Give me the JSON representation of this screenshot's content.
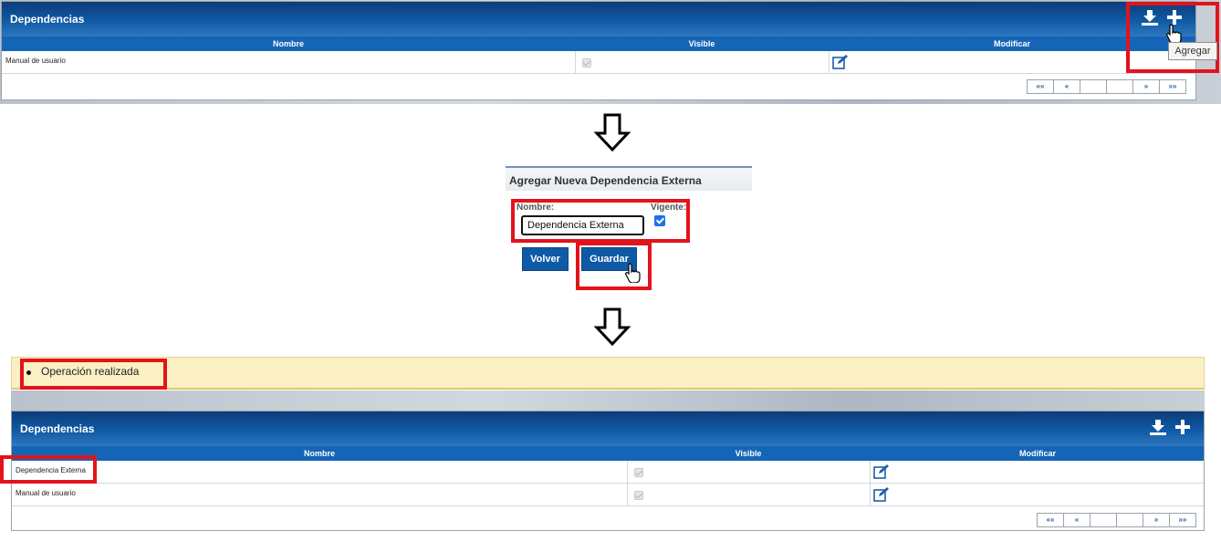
{
  "top_panel": {
    "title": "Dependencias",
    "columns": {
      "name": "Nombre",
      "visible": "Visible",
      "modify": "Modificar"
    },
    "rows": [
      {
        "name": "Manual de usuario"
      }
    ],
    "tooltip": "Agregar",
    "pager": [
      "««",
      "«",
      "",
      "",
      "»",
      "»»"
    ]
  },
  "form": {
    "title": "Agregar Nueva Dependencia Externa",
    "name_label": "Nombre:",
    "name_value": "Dependencia Externa",
    "vigente_label": "Vigente:",
    "vigente_checked": true,
    "back_label": "Volver",
    "save_label": "Guardar"
  },
  "message": {
    "text": "Operación realizada"
  },
  "bottom_panel": {
    "title": "Dependencias",
    "columns": {
      "name": "Nombre",
      "visible": "Visible",
      "modify": "Modificar"
    },
    "rows": [
      {
        "name": "Dependencia Externa"
      },
      {
        "name": "Manual de usuario"
      }
    ],
    "pager": [
      "««",
      "«",
      "",
      "",
      "»",
      "»»"
    ]
  },
  "colors": {
    "header_blue": "#0f5aa6",
    "highlight_red": "#e3131b",
    "message_bg": "#fbf0c4"
  }
}
